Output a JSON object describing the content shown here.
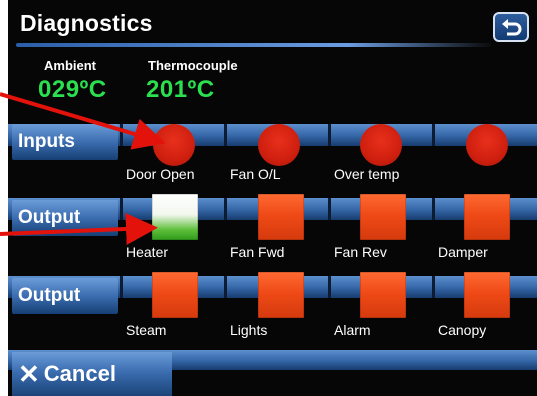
{
  "header": {
    "title": "Diagnostics",
    "back_icon": "return-arrow-icon"
  },
  "readings": {
    "ambient_label": "Ambient",
    "ambient_value": "029ºC",
    "thermocouple_label": "Thermocouple",
    "thermocouple_value": "201ºC"
  },
  "inputs": {
    "label": "Inputs",
    "items": [
      {
        "label": "Door Open",
        "state": "on"
      },
      {
        "label": "Fan O/L",
        "state": "on"
      },
      {
        "label": "Over temp",
        "state": "on"
      },
      {
        "label": "",
        "state": "on"
      }
    ]
  },
  "output1": {
    "label": "Output",
    "items": [
      {
        "label": "Heater",
        "state": "on"
      },
      {
        "label": "Fan Fwd",
        "state": "off"
      },
      {
        "label": "Fan Rev",
        "state": "off"
      },
      {
        "label": "Damper",
        "state": "off"
      }
    ]
  },
  "output2": {
    "label": "Output",
    "items": [
      {
        "label": "Steam",
        "state": "off"
      },
      {
        "label": "Lights",
        "state": "off"
      },
      {
        "label": "Alarm",
        "state": "off"
      },
      {
        "label": "Canopy",
        "state": "off"
      }
    ]
  },
  "footer": {
    "cancel_label": "Cancel",
    "cancel_icon": "close-x-icon"
  },
  "colors": {
    "accent_blue": "#3465a6",
    "temp_green": "#2be04f",
    "led_red": "#cf1f0f",
    "relay_off": "#ef4a17",
    "relay_on_green": "#5dbf3a",
    "annotation_arrow": "#e3120b"
  }
}
